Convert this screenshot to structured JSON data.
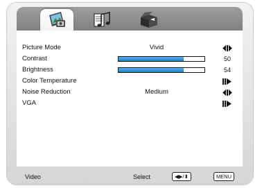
{
  "tabs": [
    {
      "icon": "picture-icon",
      "active": true
    },
    {
      "icon": "music-icon",
      "active": false
    },
    {
      "icon": "setup-box-icon",
      "active": false
    }
  ],
  "menu": {
    "picture_mode": {
      "label": "Picture Mode",
      "value": "Vivid"
    },
    "contrast": {
      "label": "Contrast",
      "value": "50",
      "level": 0.76
    },
    "brightness": {
      "label": "Brightness",
      "value": "54",
      "level": 0.76
    },
    "color_temperature": {
      "label": "Color Temperature"
    },
    "noise_reduction": {
      "label": "Noise Reduction",
      "value": "Medium"
    },
    "vga": {
      "label": "VGA"
    }
  },
  "footer": {
    "source": "Video",
    "select_label": "Select",
    "select_key": "◀▶/⬍",
    "menu_key": "MENU"
  },
  "colors": {
    "slider_fill": "#1b7fc6",
    "tab_bar": "#8a8a8a"
  }
}
